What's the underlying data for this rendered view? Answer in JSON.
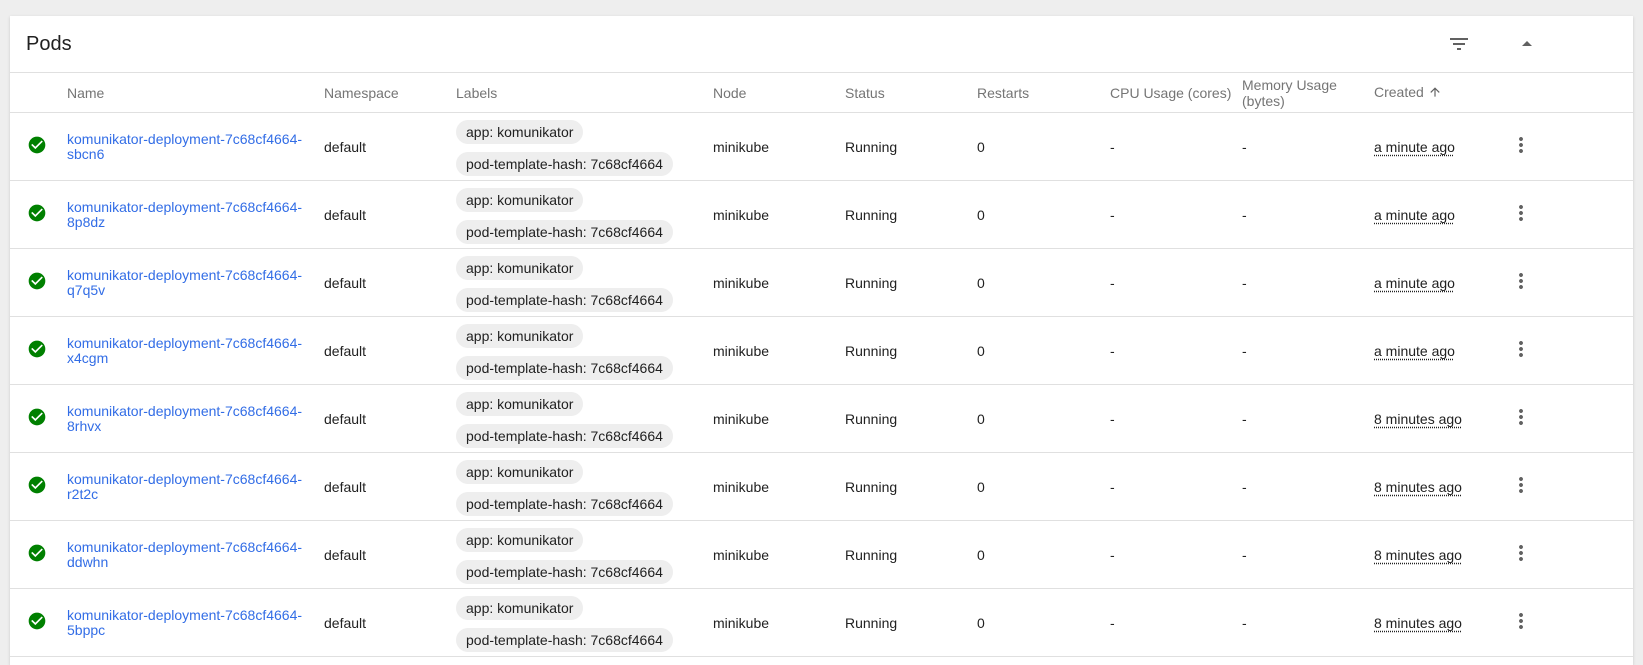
{
  "card": {
    "title": "Pods",
    "filter_icon": "filter-list-icon",
    "collapse_icon": "arrow-drop-up-icon"
  },
  "columns": {
    "name": "Name",
    "namespace": "Namespace",
    "labels": "Labels",
    "node": "Node",
    "status": "Status",
    "restarts": "Restarts",
    "cpu": "CPU Usage (cores)",
    "memory": "Memory Usage\n(bytes)",
    "created": "Created"
  },
  "colors": {
    "link": "#326de6",
    "status_ok": "#008000",
    "chip_bg": "#eeeeee"
  },
  "rows": [
    {
      "name": "komunikator-deployment-7c68cf4664-\nsbcn6",
      "namespace": "default",
      "label_app": "app: komunikator",
      "label_hash": "pod-template-hash: 7c68cf4664",
      "node": "minikube",
      "status": "Running",
      "restarts": "0",
      "cpu": "-",
      "memory": "-",
      "created": "a minute ago"
    },
    {
      "name": "komunikator-deployment-7c68cf4664-\n8p8dz",
      "namespace": "default",
      "label_app": "app: komunikator",
      "label_hash": "pod-template-hash: 7c68cf4664",
      "node": "minikube",
      "status": "Running",
      "restarts": "0",
      "cpu": "-",
      "memory": "-",
      "created": "a minute ago"
    },
    {
      "name": "komunikator-deployment-7c68cf4664-\nq7q5v",
      "namespace": "default",
      "label_app": "app: komunikator",
      "label_hash": "pod-template-hash: 7c68cf4664",
      "node": "minikube",
      "status": "Running",
      "restarts": "0",
      "cpu": "-",
      "memory": "-",
      "created": "a minute ago"
    },
    {
      "name": "komunikator-deployment-7c68cf4664-\nx4cgm",
      "namespace": "default",
      "label_app": "app: komunikator",
      "label_hash": "pod-template-hash: 7c68cf4664",
      "node": "minikube",
      "status": "Running",
      "restarts": "0",
      "cpu": "-",
      "memory": "-",
      "created": "a minute ago"
    },
    {
      "name": "komunikator-deployment-7c68cf4664-\n8rhvx",
      "namespace": "default",
      "label_app": "app: komunikator",
      "label_hash": "pod-template-hash: 7c68cf4664",
      "node": "minikube",
      "status": "Running",
      "restarts": "0",
      "cpu": "-",
      "memory": "-",
      "created": "8 minutes ago"
    },
    {
      "name": "komunikator-deployment-7c68cf4664-\nr2t2c",
      "namespace": "default",
      "label_app": "app: komunikator",
      "label_hash": "pod-template-hash: 7c68cf4664",
      "node": "minikube",
      "status": "Running",
      "restarts": "0",
      "cpu": "-",
      "memory": "-",
      "created": "8 minutes ago"
    },
    {
      "name": "komunikator-deployment-7c68cf4664-\nddwhn",
      "namespace": "default",
      "label_app": "app: komunikator",
      "label_hash": "pod-template-hash: 7c68cf4664",
      "node": "minikube",
      "status": "Running",
      "restarts": "0",
      "cpu": "-",
      "memory": "-",
      "created": "8 minutes ago"
    },
    {
      "name": "komunikator-deployment-7c68cf4664-\n5bppc",
      "namespace": "default",
      "label_app": "app: komunikator",
      "label_hash": "pod-template-hash: 7c68cf4664",
      "node": "minikube",
      "status": "Running",
      "restarts": "0",
      "cpu": "-",
      "memory": "-",
      "created": "8 minutes ago"
    }
  ]
}
